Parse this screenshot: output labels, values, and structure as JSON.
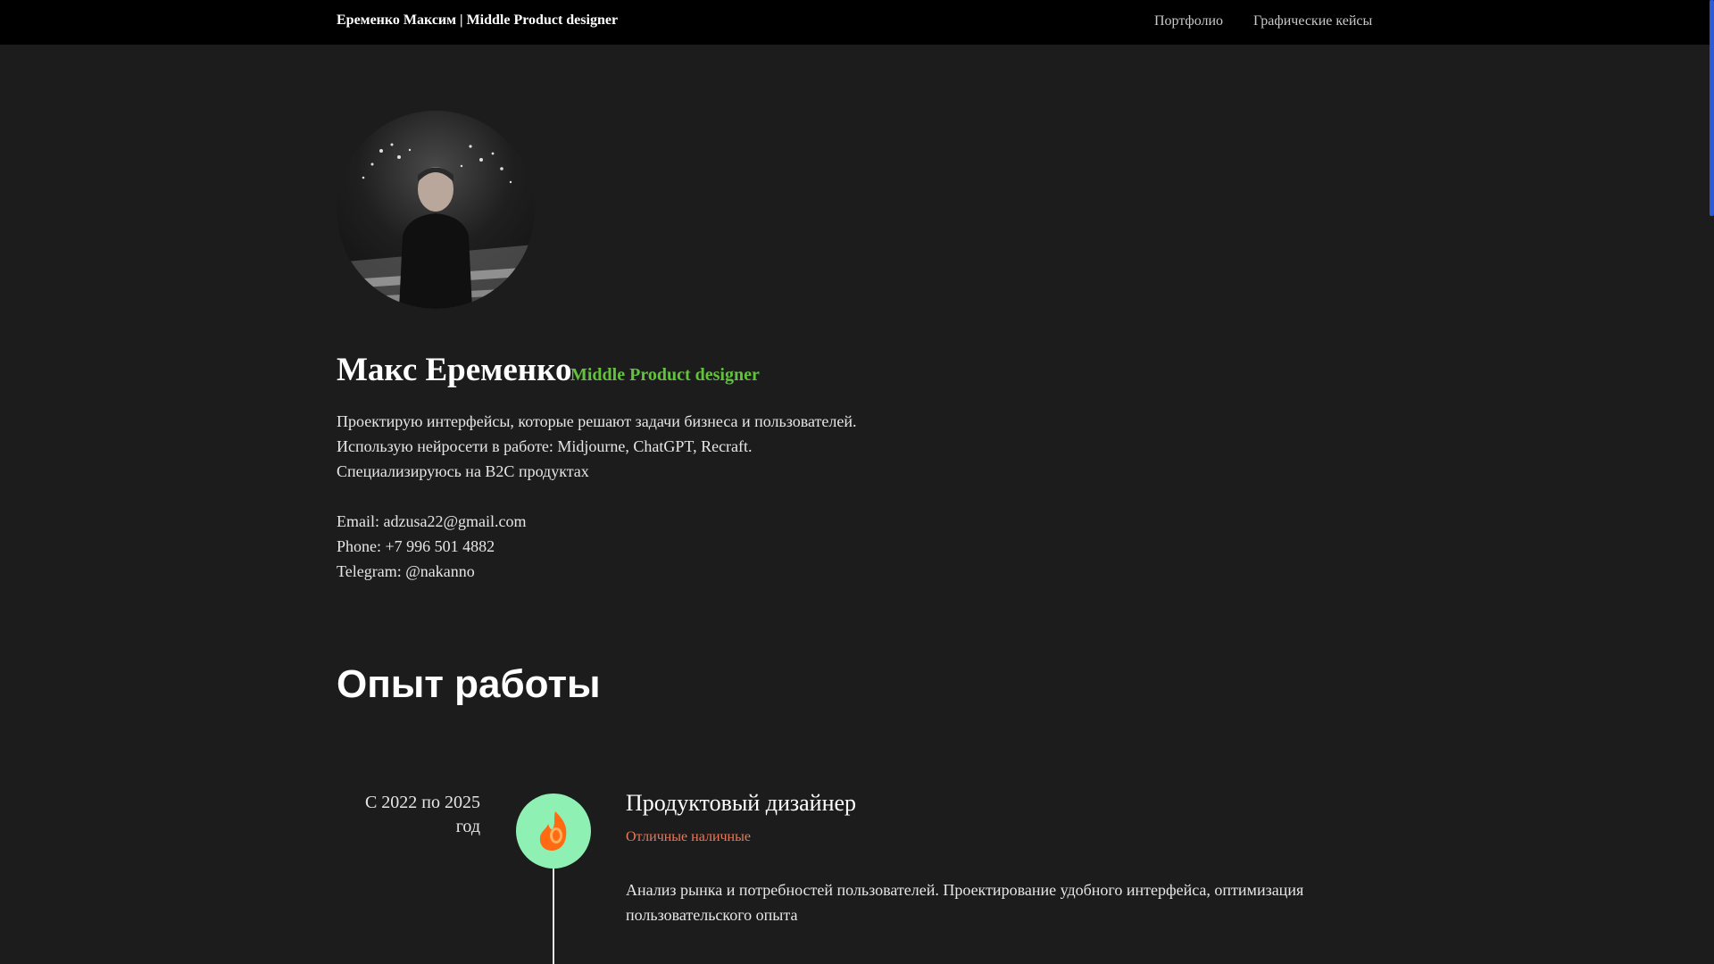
{
  "nav": {
    "brand": "Еременко Максим | Middle Product designer",
    "links": [
      {
        "label": "Портфолио"
      },
      {
        "label": "Графические кейсы"
      }
    ]
  },
  "hero": {
    "name": "Макс Еременко",
    "role": "Middle Product designer",
    "bio": [
      "Проектирую интерфейсы, которые решают задачи бизнеса и пользователей.",
      "Использую нейросети в работе: Midjourne, ChatGPT, Recraft.",
      "Специализируюсь на B2C продуктах"
    ],
    "contacts": [
      "Email: adzusa22@gmail.com",
      "Phone: +7 996 501 4882",
      "Telegram: @nakanno"
    ]
  },
  "experience": {
    "title": "Опыт работы",
    "jobs": [
      {
        "period": "С 2022 по 2025 год",
        "title": "Продуктовый дизайнер",
        "company": "Отличные наличные",
        "description": "Анализ рынка и потребностей пользователей. Проектирование удобного интерфейса, оптимизация пользовательского опыта",
        "logo_icon": "coin-flame-icon"
      }
    ]
  },
  "colors": {
    "background": "#1c1c1c",
    "navbar": "#000000",
    "accent_green": "#62c23c",
    "company_orange": "#e8795a",
    "logo_bg": "#8ff0b3",
    "scroll_thumb": "#2d5bd7"
  }
}
